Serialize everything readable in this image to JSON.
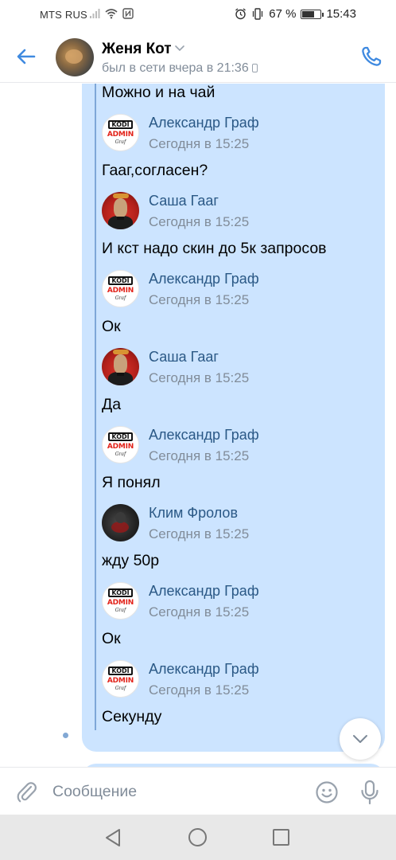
{
  "status_bar": {
    "carrier": "MTS RUS",
    "battery_percent": "67 %",
    "battery_level": 0.67,
    "time": "15:43"
  },
  "header": {
    "contact_name": "Женя Кот",
    "last_seen": "был в сети вчера в 21:36"
  },
  "messages": [
    {
      "type": "text",
      "text": "Можно и на чай"
    },
    {
      "type": "author",
      "avatar": "kodi-admin-avatar",
      "name": "Александр Граф",
      "time": "Сегодня в 15:25"
    },
    {
      "type": "text",
      "text": "Гааг,согласен?"
    },
    {
      "type": "author",
      "avatar": "sasha-avatar",
      "name": "Саша Гааг",
      "time": "Сегодня в 15:25"
    },
    {
      "type": "text",
      "text": "И кст надо скин до 5к запросов"
    },
    {
      "type": "author",
      "avatar": "kodi-admin-avatar",
      "name": "Александр Граф",
      "time": "Сегодня в 15:25"
    },
    {
      "type": "text",
      "text": "Ок"
    },
    {
      "type": "author",
      "avatar": "sasha-avatar",
      "name": "Саша Гааг",
      "time": "Сегодня в 15:25"
    },
    {
      "type": "text",
      "text": "Да"
    },
    {
      "type": "author",
      "avatar": "kodi-admin-avatar",
      "name": "Александр Граф",
      "time": "Сегодня в 15:25"
    },
    {
      "type": "text",
      "text": "Я понял"
    },
    {
      "type": "author",
      "avatar": "klim-avatar",
      "name": "Клим Фролов",
      "time": "Сегодня в 15:25"
    },
    {
      "type": "text",
      "text": "жду 50р"
    },
    {
      "type": "author",
      "avatar": "kodi-admin-avatar",
      "name": "Александр Граф",
      "time": "Сегодня в 15:25"
    },
    {
      "type": "text",
      "text": "Ок"
    },
    {
      "type": "author",
      "avatar": "kodi-admin-avatar",
      "name": "Александр Граф",
      "time": "Сегодня в 15:25"
    },
    {
      "type": "text",
      "text": "Секунду"
    }
  ],
  "kodi_logo": {
    "line1": "KODI",
    "line2": "ADMIN",
    "line3": "Graf"
  },
  "composer": {
    "placeholder": "Сообщение"
  },
  "colors": {
    "accent": "#3f8ae0",
    "bubble": "#cce4ff",
    "author_link": "#2a5885",
    "secondary_text": "#818c99"
  },
  "icons": [
    "back-arrow-icon",
    "chevron-down-icon",
    "phone-icon",
    "scroll-down-chevron-icon",
    "paperclip-icon",
    "emoji-icon",
    "microphone-icon",
    "nav-back-icon",
    "nav-home-icon",
    "nav-recent-icon"
  ]
}
